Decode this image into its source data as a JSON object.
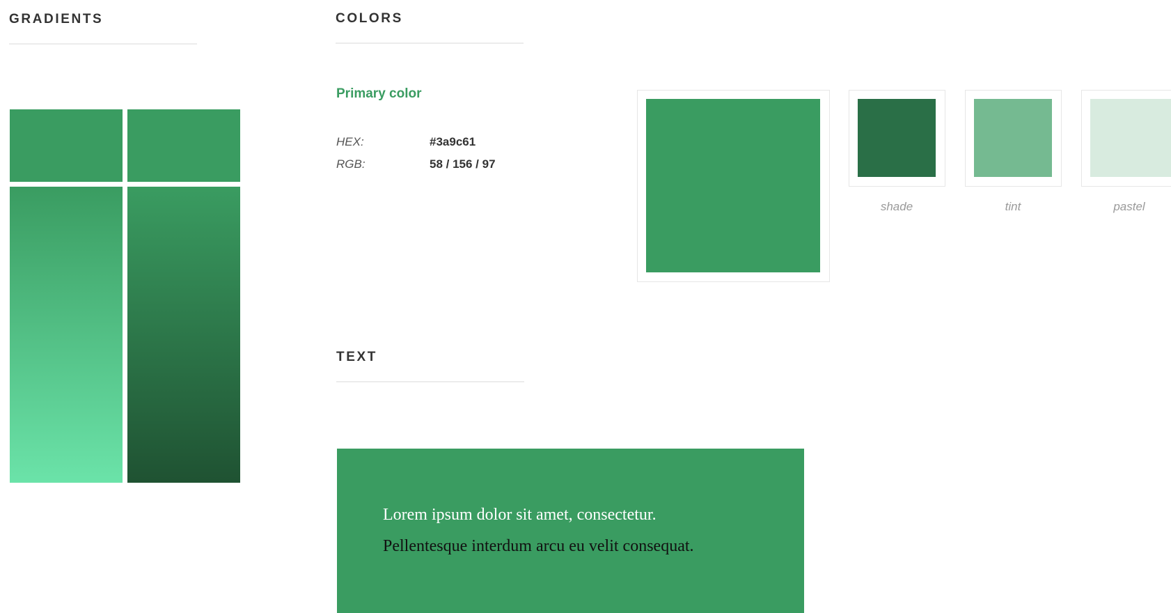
{
  "gradients": {
    "title": "GRADIENTS",
    "light": {
      "top_color": "#3a9c61",
      "from": "#3a9c61",
      "to": "#6be3a9"
    },
    "dark": {
      "top_color": "#3a9c61",
      "from": "#3a9c61",
      "to": "#1f5232"
    }
  },
  "colors": {
    "title": "COLORS",
    "primary_label": "Primary color",
    "hex_key": "HEX:",
    "hex_value": "#3a9c61",
    "rgb_key": "RGB:",
    "rgb_value": "58 / 156 / 97",
    "primary": "#3a9c61",
    "variants": [
      {
        "label": "shade",
        "color": "#2a6f47"
      },
      {
        "label": "tint",
        "color": "#75ba91"
      },
      {
        "label": "pastel",
        "color": "#d8ebdf"
      }
    ]
  },
  "text": {
    "title": "TEXT",
    "background": "#3a9c61",
    "line1": "Lorem ipsum dolor sit amet, consectetur.",
    "line1_color": "#ffffff",
    "line2": "Pellentesque interdum arcu eu velit consequat.",
    "line2_color": "#111111"
  }
}
